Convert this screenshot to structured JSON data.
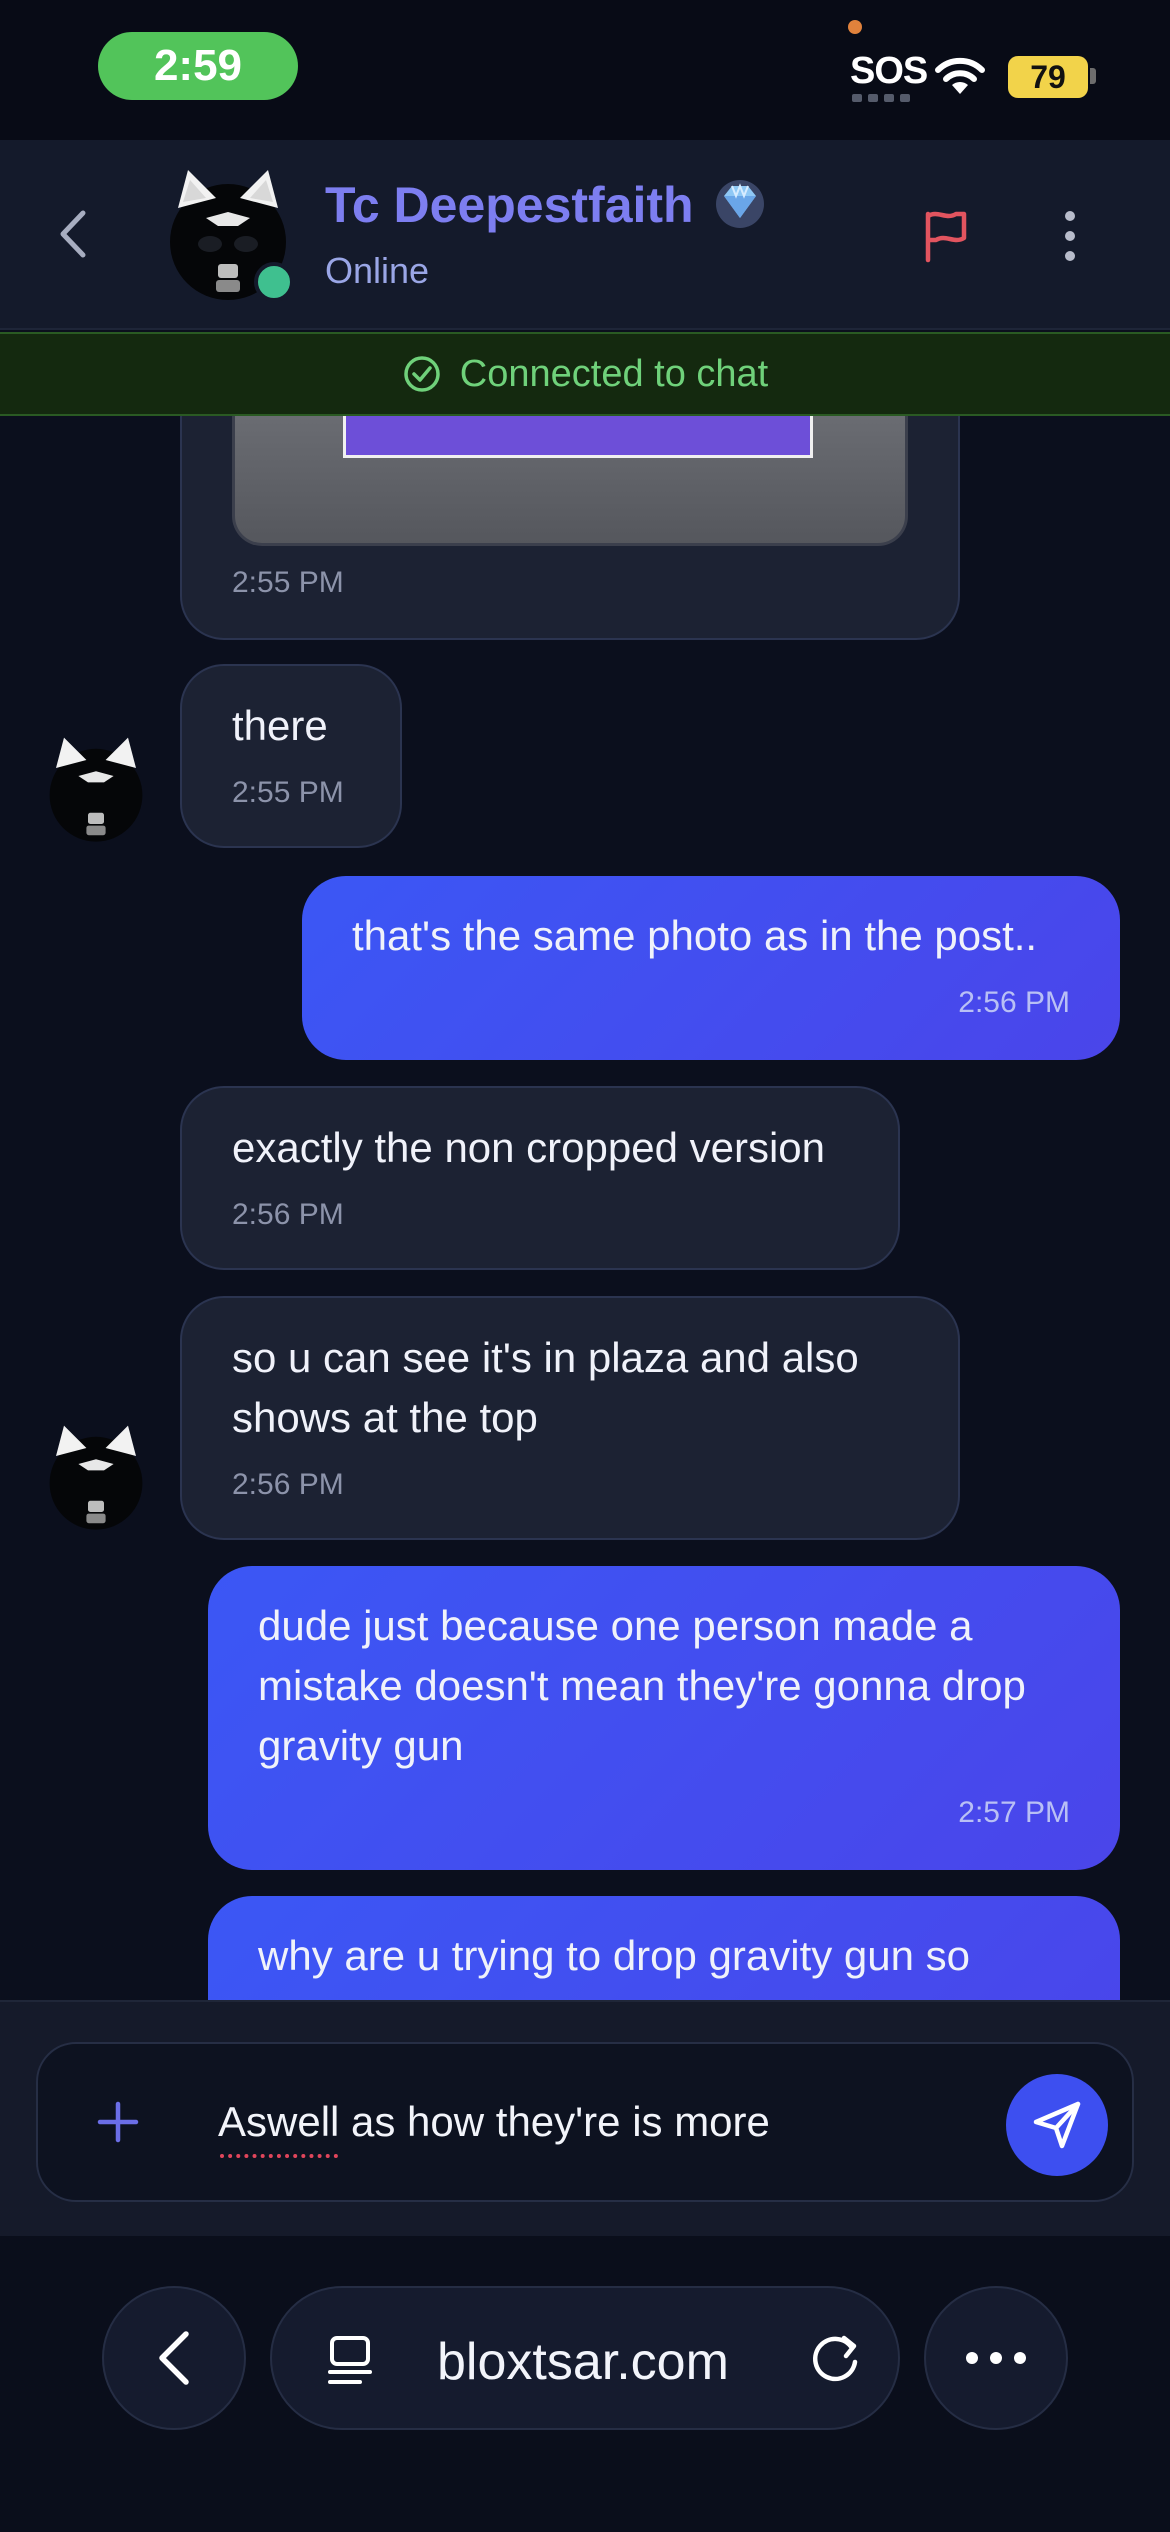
{
  "status_bar": {
    "time": "2:59",
    "sos": "SOS",
    "battery": "79"
  },
  "header": {
    "name": "Tc Deepestfaith",
    "status": "Online"
  },
  "banner": {
    "text": "Connected to chat"
  },
  "messages": [
    {
      "id": "m0",
      "side": "in",
      "type": "image",
      "time": "2:55 PM"
    },
    {
      "id": "m1",
      "side": "in",
      "text": "there",
      "time": "2:55 PM"
    },
    {
      "id": "m2",
      "side": "out",
      "text": "that's the same photo as in the post..",
      "time": "2:56 PM"
    },
    {
      "id": "m3",
      "side": "in",
      "text": "exactly the non cropped version",
      "time": "2:56 PM"
    },
    {
      "id": "m4",
      "side": "in",
      "lines": [
        "so u can see it's in plaza and also",
        "shows at the top"
      ],
      "time": "2:56 PM"
    },
    {
      "id": "m5",
      "side": "out",
      "lines": [
        "dude just because one person made a",
        "mistake doesn't mean they're gonna drop",
        "gravity gun"
      ],
      "time": "2:57 PM"
    },
    {
      "id": "m6",
      "side": "out",
      "text": "why are u trying to drop gravity gun so"
    }
  ],
  "composer": {
    "value": "Aswell as how they're is more"
  },
  "browser": {
    "url": "bloxtsar.com"
  }
}
